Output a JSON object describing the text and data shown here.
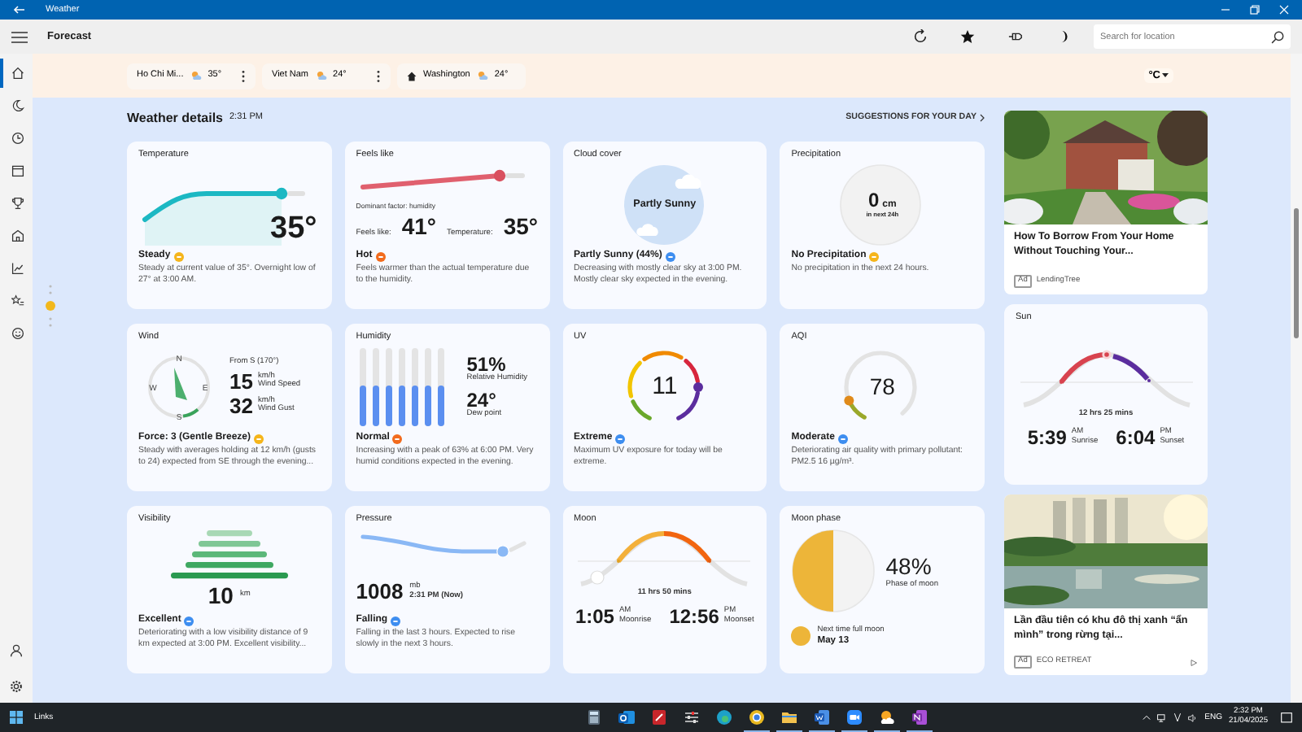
{
  "window": {
    "title": "Weather"
  },
  "app_bar": {
    "title": "Forecast",
    "search": {
      "placeholder": "Search for location"
    }
  },
  "sidebar": {
    "items": [
      {
        "selected": true
      },
      {
        "selected": false
      },
      {
        "selected": false
      },
      {
        "selected": false
      },
      {
        "selected": false
      },
      {
        "selected": false
      },
      {
        "selected": false
      },
      {
        "selected": false
      },
      {
        "selected": false
      }
    ]
  },
  "locations": [
    {
      "name": "Ho Chi Mi...",
      "temp": "35°",
      "home": false,
      "menu": true
    },
    {
      "name": "Viet Nam",
      "temp": "24°",
      "home": false,
      "menu": true
    },
    {
      "name": "Washington",
      "temp": "24°",
      "home": true,
      "menu": false
    }
  ],
  "unit": "°C",
  "details": {
    "title": "Weather details",
    "time": "2:31 PM",
    "suggestions": "SUGGESTIONS FOR YOUR DAY"
  },
  "cards": [
    {
      "kind": "temperature",
      "title": "Temperature",
      "value": "35°",
      "status": "Steady",
      "color": "#f5b51b",
      "description": "Steady at current value of 35°. Overnight low of 27° at 3:00 AM."
    },
    {
      "kind": "feels_like",
      "title": "Feels like",
      "factor": "Dominant factor: humidity",
      "feels_label": "Feels like:",
      "feels_value": "41°",
      "temp_label": "Temperature:",
      "temp_value": "35°",
      "status": "Hot",
      "color": "#f26b1d",
      "description": "Feels warmer than the actual temperature due to the humidity."
    },
    {
      "kind": "cloud",
      "title": "Cloud cover",
      "center": "Partly Sunny",
      "status": "Partly Sunny (44%)",
      "color": "#3e8ef0",
      "description": "Decreasing with mostly clear sky at 3:00 PM. Mostly clear sky expected in the evening."
    },
    {
      "kind": "precipitation",
      "title": "Precipitation",
      "value": "0",
      "unit": "cm",
      "note": "in next 24h",
      "status": "No Precipitation",
      "color": "#f5b51b",
      "description": "No precipitation in the next 24 hours."
    },
    {
      "kind": "wind",
      "title": "Wind",
      "compass": [
        "N",
        "W",
        "E",
        "S"
      ],
      "direction": "From S (170°)",
      "speed": "15",
      "speed_unit": "km/h",
      "speed_label": "Wind Speed",
      "gust": "32",
      "gust_unit": "km/h",
      "gust_label": "Wind Gust",
      "status": "Force: 3 (Gentle Breeze)",
      "color": "#f5b51b",
      "description": "Steady with averages holding at 12 km/h (gusts to 24) expected from SE through the evening..."
    },
    {
      "kind": "humidity",
      "title": "Humidity",
      "value": "51%",
      "value_label": "Relative Humidity",
      "dew": "24°",
      "dew_label": "Dew point",
      "status": "Normal",
      "color": "#f26b1d",
      "description": "Increasing with a peak of 63% at 6:00 PM. Very humid conditions expected in the evening."
    },
    {
      "kind": "uv",
      "title": "UV",
      "value": "11",
      "status": "Extreme",
      "color": "#3e8ef0",
      "description": "Maximum UV exposure for today will be extreme."
    },
    {
      "kind": "aqi",
      "title": "AQI",
      "value": "78",
      "status": "Moderate",
      "color": "#3e8ef0",
      "description": "Deteriorating air quality with primary pollutant: PM2.5 16 µg/m³."
    },
    {
      "kind": "visibility",
      "title": "Visibility",
      "value": "10",
      "unit": "km",
      "status": "Excellent",
      "color": "#3e8ef0",
      "description": "Deteriorating with a low visibility distance of 9 km expected at 3:00 PM. Excellent visibility..."
    },
    {
      "kind": "pressure",
      "title": "Pressure",
      "value": "1008",
      "unit": "mb",
      "time": "2:31 PM (Now)",
      "status": "Falling",
      "color": "#3e8ef0",
      "description": "Falling in the last 3 hours. Expected to rise slowly in the next 3 hours."
    },
    {
      "kind": "moon",
      "title": "Moon",
      "duration": "11 hrs 50 mins",
      "rise": "1:05",
      "rise_period": "AM",
      "rise_label": "Moonrise",
      "set": "12:56",
      "set_period": "PM",
      "set_label": "Moonset"
    },
    {
      "kind": "moon_phase",
      "title": "Moon phase",
      "value": "48%",
      "value_label": "Phase of moon",
      "next_label": "Next time full moon",
      "next_date": "May 13"
    }
  ],
  "side": [
    {
      "kind": "ad",
      "title": "How To Borrow From Your Home Without Touching Your...",
      "ad_label": "Ad",
      "sponsor": "LendingTree",
      "choices": false
    },
    {
      "kind": "sun",
      "title": "Sun",
      "duration": "12 hrs 25 mins",
      "rise": "5:39",
      "rise_period": "AM",
      "rise_label": "Sunrise",
      "set": "6:04",
      "set_period": "PM",
      "set_label": "Sunset"
    },
    {
      "kind": "ad",
      "title": "Lần đầu tiên có khu đô thị xanh “ẩn mình” trong rừng tại...",
      "ad_label": "Ad",
      "sponsor": "ECO RETREAT",
      "choices": true
    }
  ],
  "taskbar": {
    "label": "Links",
    "apps": [
      {
        "open": false
      },
      {
        "open": false
      },
      {
        "open": false
      },
      {
        "open": false
      },
      {
        "open": false
      },
      {
        "open": true
      },
      {
        "open": true
      },
      {
        "open": true
      },
      {
        "open": true
      },
      {
        "open": true
      },
      {
        "open": true
      }
    ],
    "language": "ENG",
    "time": "2:32 PM",
    "date": "21/04/2025"
  }
}
